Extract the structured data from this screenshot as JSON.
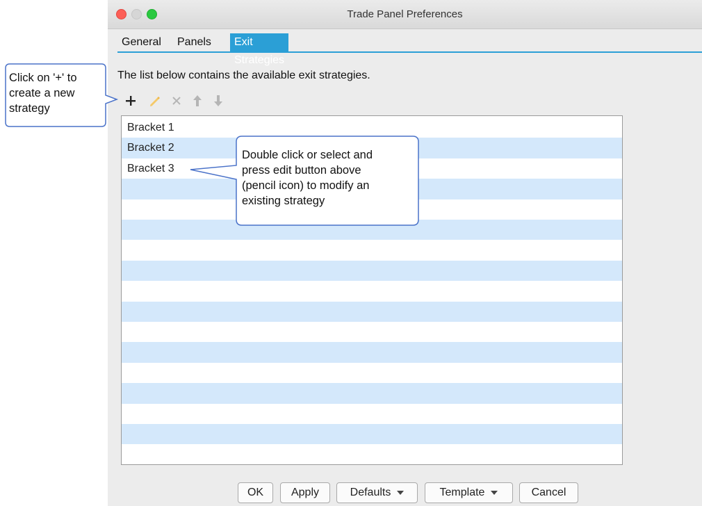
{
  "window": {
    "title": "Trade Panel Preferences"
  },
  "tabs": [
    {
      "label": "General"
    },
    {
      "label": "Panels"
    },
    {
      "label": "Exit Strategies"
    }
  ],
  "description": "The list below contains the available exit strategies.",
  "toolbar": {
    "add_icon": "plus-icon",
    "edit_icon": "pencil-icon",
    "delete_icon": "x-icon",
    "move_up_icon": "arrow-up-icon",
    "move_down_icon": "arrow-down-icon"
  },
  "strategies": [
    {
      "name": "Bracket 1"
    },
    {
      "name": "Bracket 2"
    },
    {
      "name": "Bracket 3"
    }
  ],
  "buttons": {
    "ok": "OK",
    "apply": "Apply",
    "defaults": "Defaults",
    "template": "Template",
    "cancel": "Cancel"
  },
  "callouts": {
    "add_lines": [
      "Click on '+' to",
      "create a new",
      "strategy"
    ],
    "edit_lines": [
      "Double click or select and",
      "press edit button above",
      "(pencil icon) to modify an",
      "existing strategy"
    ]
  },
  "colors": {
    "accent": "#2b9fd6",
    "row_stripe": "#d4e8fb",
    "callout_border": "#4a72c9"
  }
}
